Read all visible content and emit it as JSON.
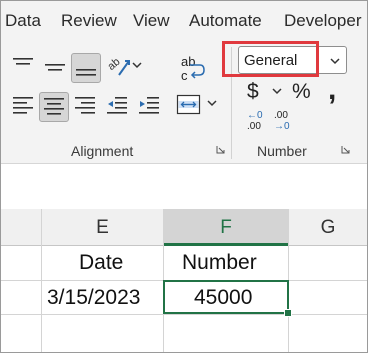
{
  "ribbon_tabs": [
    "Data",
    "Review",
    "View",
    "Automate",
    "Developer"
  ],
  "alignment_group": {
    "label": "Alignment",
    "orientation_glyph": "ab"
  },
  "number_group": {
    "label": "Number",
    "format_value": "General",
    "currency_symbol": "$",
    "percent_symbol": "%",
    "comma_symbol": ",",
    "increase_decimal_top": "←0",
    "increase_decimal_bottom": ".00",
    "decrease_decimal_top": ".00",
    "decrease_decimal_bottom": "→0"
  },
  "wrap_text_top": "ab",
  "wrap_text_bottom": "c",
  "columns": [
    "E",
    "F",
    "G"
  ],
  "cells": {
    "e_header": "Date",
    "f_header": "Number",
    "e_value": "3/15/2023",
    "f_value": "45000"
  },
  "colors": {
    "accent": "#217346",
    "highlight_box": "#e0393e",
    "ribbon_bg": "#f3f3f3"
  }
}
